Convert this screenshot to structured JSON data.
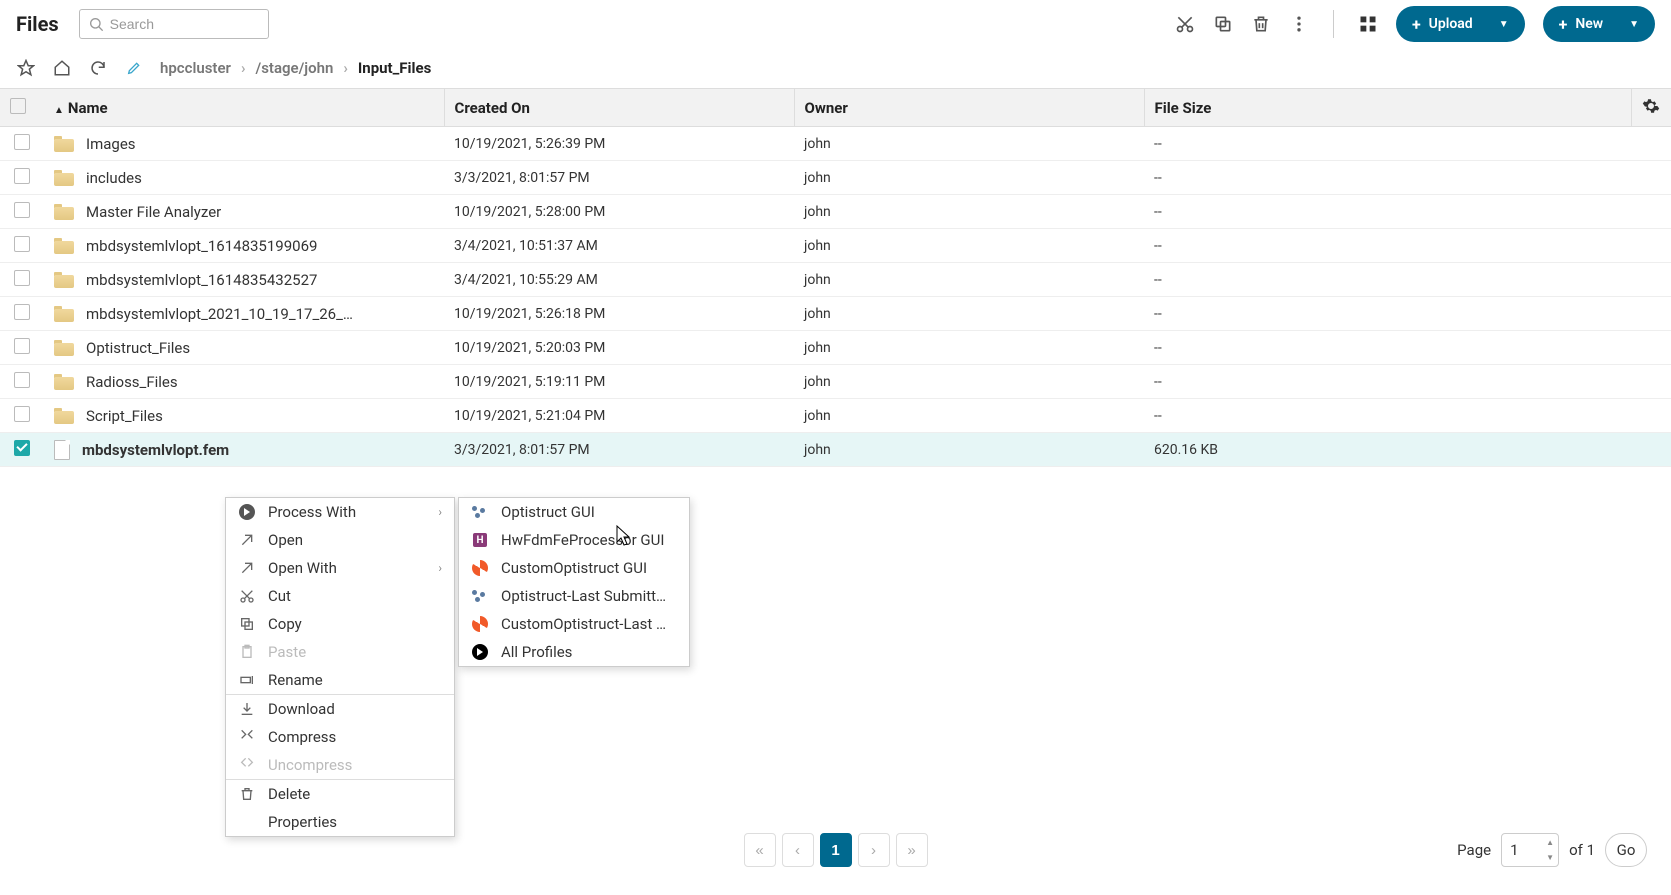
{
  "title": "Files",
  "search": {
    "placeholder": "Search"
  },
  "buttons": {
    "upload": "Upload",
    "new": "New"
  },
  "breadcrumb": {
    "parts": [
      "hpccluster",
      "/stage/john",
      "Input_Files"
    ]
  },
  "columns": {
    "name": "Name",
    "created": "Created On",
    "owner": "Owner",
    "size": "File Size"
  },
  "rows": [
    {
      "type": "folder",
      "name": "Images",
      "created": "10/19/2021, 5:26:39 PM",
      "owner": "john",
      "size": "--",
      "selected": false
    },
    {
      "type": "folder",
      "name": "includes",
      "created": "3/3/2021, 8:01:57 PM",
      "owner": "john",
      "size": "--",
      "selected": false
    },
    {
      "type": "folder",
      "name": "Master File Analyzer",
      "created": "10/19/2021, 5:28:00 PM",
      "owner": "john",
      "size": "--",
      "selected": false
    },
    {
      "type": "folder",
      "name": "mbdsystemlvlopt_1614835199069",
      "created": "3/4/2021, 10:51:37 AM",
      "owner": "john",
      "size": "--",
      "selected": false
    },
    {
      "type": "folder",
      "name": "mbdsystemlvlopt_1614835432527",
      "created": "3/4/2021, 10:55:29 AM",
      "owner": "john",
      "size": "--",
      "selected": false
    },
    {
      "type": "folder",
      "name": "mbdsystemlvlopt_2021_10_19_17_26_…",
      "created": "10/19/2021, 5:26:18 PM",
      "owner": "john",
      "size": "--",
      "selected": false
    },
    {
      "type": "folder",
      "name": "Optistruct_Files",
      "created": "10/19/2021, 5:20:03 PM",
      "owner": "john",
      "size": "--",
      "selected": false
    },
    {
      "type": "folder",
      "name": "Radioss_Files",
      "created": "10/19/2021, 5:19:11 PM",
      "owner": "john",
      "size": "--",
      "selected": false
    },
    {
      "type": "folder",
      "name": "Script_Files",
      "created": "10/19/2021, 5:21:04 PM",
      "owner": "john",
      "size": "--",
      "selected": false
    },
    {
      "type": "file",
      "name": "mbdsystemlvlopt.fem",
      "created": "3/3/2021, 8:01:57 PM",
      "owner": "john",
      "size": "620.16 KB",
      "selected": true
    }
  ],
  "context_main": [
    {
      "label": "Process With",
      "icon": "play",
      "sub": true
    },
    {
      "label": "Open",
      "icon": "arrow-out"
    },
    {
      "label": "Open With",
      "icon": "arrow-out",
      "sub": true
    },
    {
      "label": "Cut",
      "icon": "scissors"
    },
    {
      "label": "Copy",
      "icon": "copy"
    },
    {
      "label": "Paste",
      "icon": "clipboard",
      "disabled": true
    },
    {
      "label": "Rename",
      "icon": "rename"
    },
    {
      "sep": true
    },
    {
      "label": "Download",
      "icon": "download"
    },
    {
      "label": "Compress",
      "icon": "compress"
    },
    {
      "label": "Uncompress",
      "icon": "uncompress",
      "disabled": true
    },
    {
      "sep": true
    },
    {
      "label": "Delete",
      "icon": "trash"
    },
    {
      "label": "Properties",
      "icon": ""
    }
  ],
  "context_sub": [
    {
      "label": "Optistruct GUI",
      "icon": "dots3"
    },
    {
      "label": "HwFdmFeProcessor GUI",
      "icon": "letter-h"
    },
    {
      "label": "CustomOptistruct GUI",
      "icon": "swirl"
    },
    {
      "label": "Optistruct-Last Submitt…",
      "icon": "dots3"
    },
    {
      "label": "CustomOptistruct-Last …",
      "icon": "swirl"
    },
    {
      "label": "All Profiles",
      "icon": "play-blk"
    }
  ],
  "pagination": {
    "page": "1",
    "of_label": "of 1",
    "page_label": "Page",
    "go": "Go"
  }
}
